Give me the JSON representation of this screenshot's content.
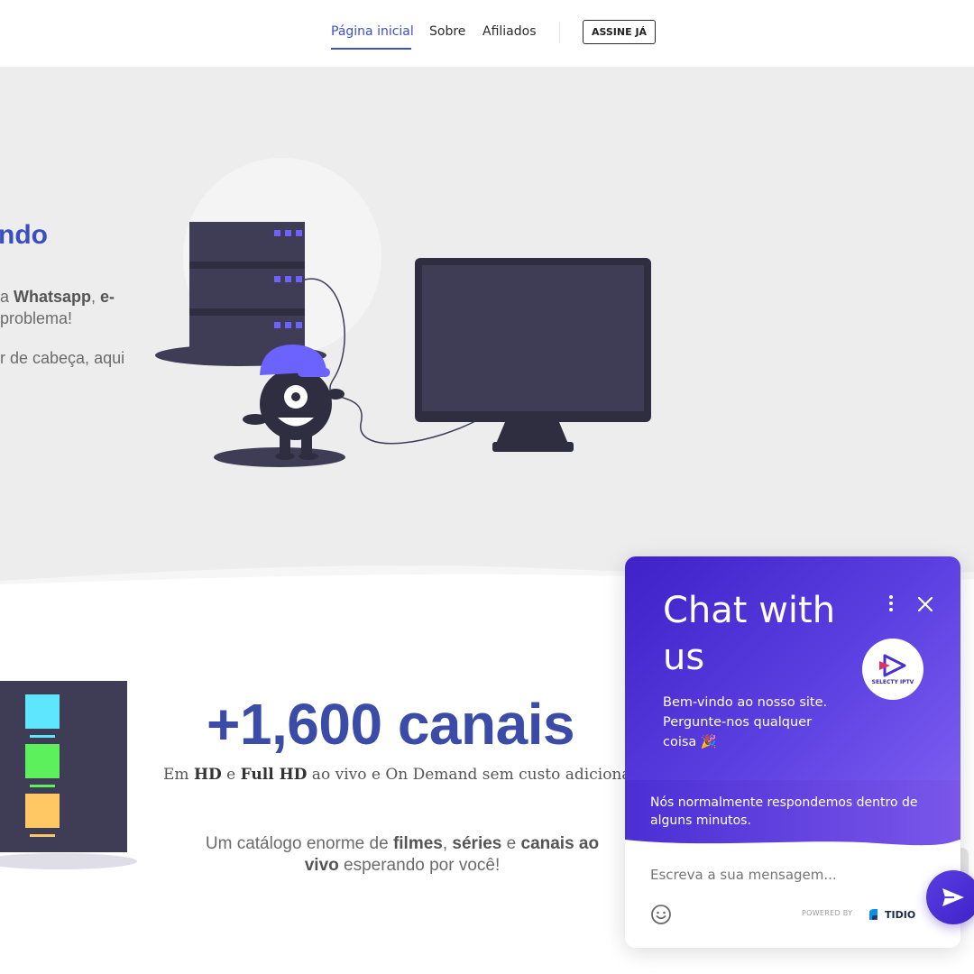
{
  "nav": {
    "links": [
      "Página inicial",
      "Sobre",
      "Afiliados"
    ],
    "cta": "ASSINE JÁ"
  },
  "hero": {
    "title": "ndo",
    "line1_a": "a ",
    "line1_b": "Whatsapp",
    "line1_c": ", ",
    "line1_d": "e-",
    "line2": "problema!",
    "line3": "r de cabeça, aqui"
  },
  "section2": {
    "title": "+1,600 canais",
    "sub_em": "Em ",
    "sub_hd": "HD",
    "sub_e": " e ",
    "sub_fullhd": "Full HD",
    "sub_rest": " ao vivo e On Demand sem custo adiciona",
    "cat_1": "Um catálogo enorme de ",
    "cat_filmes": "filmes",
    "cat_2": ", ",
    "cat_series": "séries",
    "cat_3": " e ",
    "cat_canais": "canais ao vivo",
    "cat_4": " esperando por você!"
  },
  "chat": {
    "title": "Chat with us",
    "welcome": "Bem-vindo ao nosso site. Pergunte-nos qualquer coisa 🎉",
    "logo_text": "SELECTY IPTV",
    "response_note": "Nós normalmente respondemos dentro de alguns minutos.",
    "input_placeholder": "Escreva a sua mensagem...",
    "powered_by": "POWERED BY",
    "brand": "TIDIO"
  },
  "colors": {
    "accent": "#3a4fd0",
    "chat_purple": "#4b2fd4",
    "hero_bg": "#ededed"
  }
}
